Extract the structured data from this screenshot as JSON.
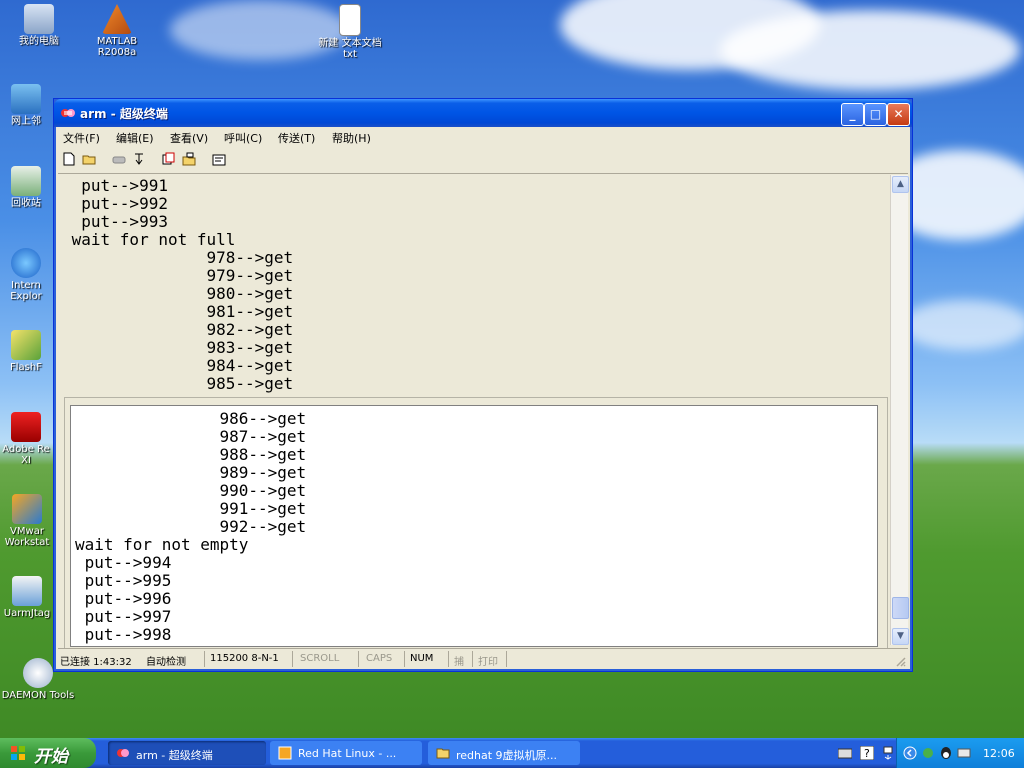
{
  "desktop": {
    "icons": [
      {
        "label": "我的电脑"
      },
      {
        "label": "MATLAB R2008a"
      },
      {
        "label": "新建 文本文档 txt"
      },
      {
        "label": "网上邻"
      },
      {
        "label": "回收站"
      },
      {
        "label": "Intern Explor"
      },
      {
        "label": "FlashF"
      },
      {
        "label": "Adobe Re XI"
      },
      {
        "label": "VMwar Workstat"
      },
      {
        "label": "UarmJtag"
      },
      {
        "label": "DAEMON Tools"
      }
    ]
  },
  "window": {
    "title": "arm - 超级终端",
    "menu": [
      "文件(F)",
      "编辑(E)",
      "查看(V)",
      "呼叫(C)",
      "传送(T)",
      "帮助(H)"
    ],
    "terminal_top": [
      "  put-->991",
      "  put-->992",
      "  put-->993",
      " wait for not full",
      "               978-->get",
      "               979-->get",
      "               980-->get",
      "               981-->get",
      "               982-->get",
      "               983-->get",
      "               984-->get",
      "               985-->get"
    ],
    "terminal_bottom": [
      "               986-->get",
      "               987-->get",
      "               988-->get",
      "               989-->get",
      "               990-->get",
      "               991-->get",
      "               992-->get",
      "wait for not empty",
      " put-->994",
      " put-->995",
      " put-->996",
      " put-->997",
      " put-->998"
    ],
    "status": {
      "connected": "已连接 1:43:32",
      "detect": "自动检测",
      "baud": "115200 8-N-1",
      "scroll": "SCROLL",
      "caps": "CAPS",
      "num": "NUM",
      "capture": "捕",
      "print": "打印"
    }
  },
  "taskbar": {
    "start_label": "开始",
    "tasks": [
      {
        "label": "arm - 超级终端"
      },
      {
        "label": "Red Hat Linux - ..."
      },
      {
        "label": "redhat 9虚拟机原..."
      }
    ],
    "clock": "12:06"
  },
  "colors": {
    "titlebar": "#0055e5",
    "taskbar": "#245edb",
    "start": "#3a9a3a",
    "tray": "#0f7fd9"
  }
}
